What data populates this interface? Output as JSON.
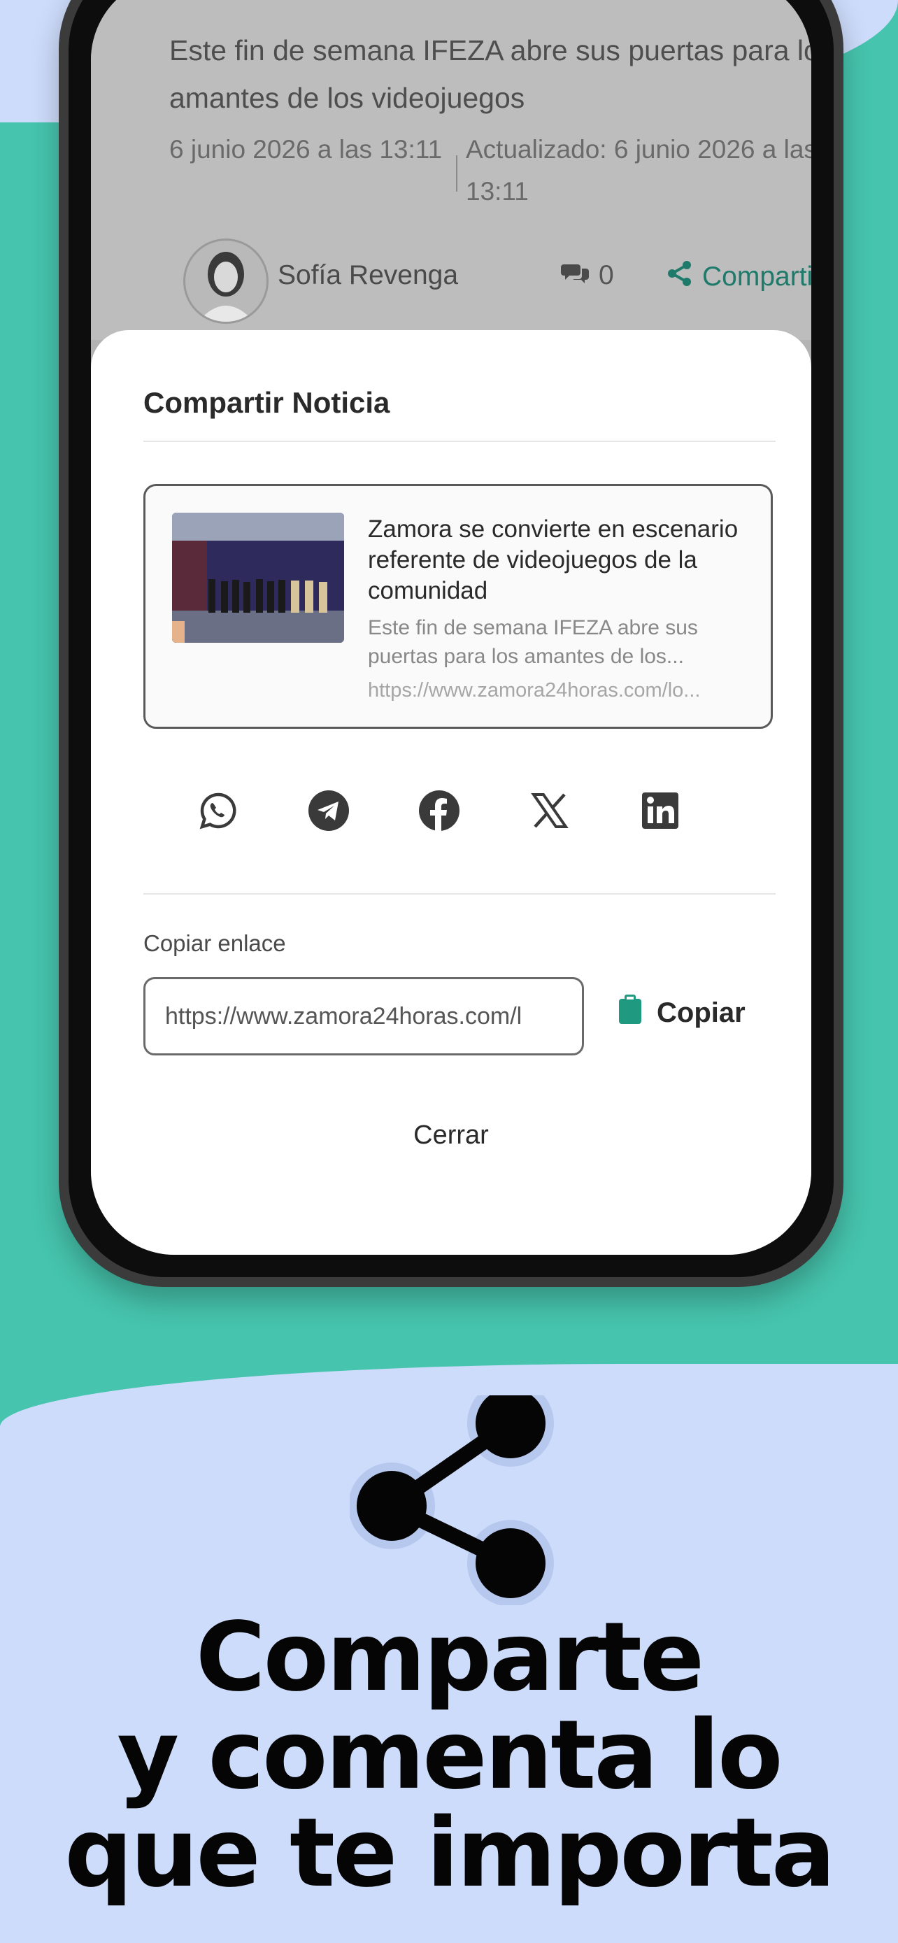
{
  "article": {
    "headline_tail": "comunidad",
    "subtitle": "Este fin de semana IFEZA abre sus puertas para los amantes de los videojuegos",
    "date": "6 junio 2026 a las 13:11",
    "updated": "Actualizado: 6 junio 2026 a las 13:11",
    "author": "Sofía Revenga",
    "comment_count": "0",
    "share_label": "Compartir"
  },
  "share_sheet": {
    "title": "Compartir Noticia",
    "preview": {
      "title": "Zamora se convierte en escenario referente de videojuegos de la comunidad",
      "description": "Este fin de semana IFEZA abre sus puertas para los amantes de los...",
      "url": "https://www.zamora24horas.com/lo..."
    },
    "social_icons": [
      "whatsapp-icon",
      "telegram-icon",
      "facebook-icon",
      "x-icon",
      "linkedin-icon"
    ],
    "copy_label": "Copiar enlace",
    "copy_value": "https://www.zamora24horas.com/l",
    "copy_button": "Copiar",
    "close_button": "Cerrar"
  },
  "promo": {
    "line1": "Comparte",
    "line2": "y comenta lo",
    "line3": "que te importa"
  },
  "colors": {
    "background_green": "#46c4ad",
    "background_blue": "#cddcfb",
    "accent_teal": "#1e7a6a",
    "clipboard_teal": "#1f9a80"
  }
}
